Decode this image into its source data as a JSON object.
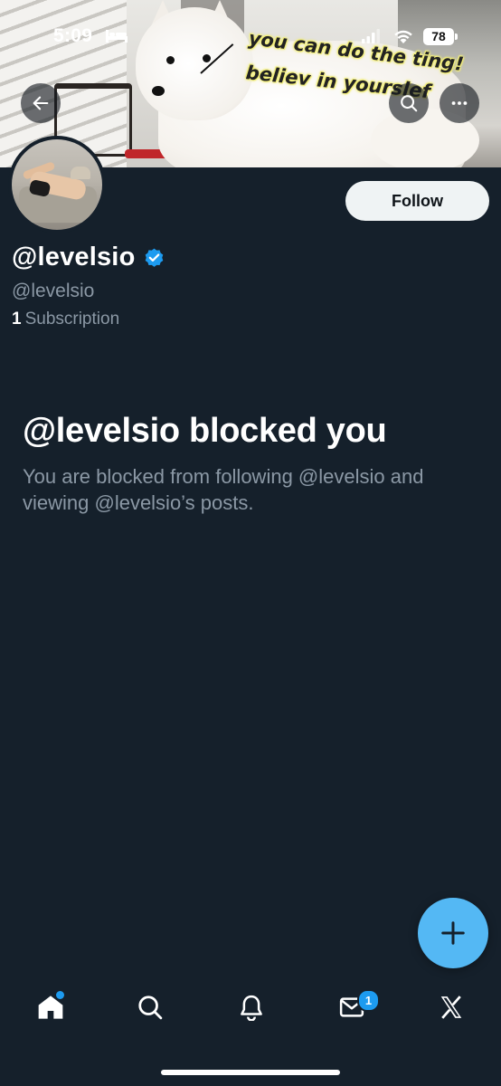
{
  "status_bar": {
    "time": "5:09",
    "battery": "78"
  },
  "banner": {
    "caption_line1": "you can do the ting!",
    "caption_line2": "believ in yourslef"
  },
  "header": {
    "back_icon": "arrow-left-icon",
    "search_icon": "search-icon",
    "more_icon": "more-horizontal-icon"
  },
  "profile": {
    "display_name": "@levelsio",
    "handle": "@levelsio",
    "subscription_count": "1",
    "subscription_label": "Subscription",
    "follow_label": "Follow",
    "verified_color": "#1d9bf0"
  },
  "blocked": {
    "title": "@levelsio blocked you",
    "description": "You are blocked from following @levelsio and viewing @levelsio’s posts."
  },
  "tabbar": {
    "items": [
      {
        "name": "home",
        "icon": "home-icon",
        "dot": true
      },
      {
        "name": "search",
        "icon": "search-icon"
      },
      {
        "name": "notifications",
        "icon": "bell-icon"
      },
      {
        "name": "messages",
        "icon": "envelope-icon",
        "badge": "1"
      },
      {
        "name": "grok",
        "icon": "x-logo-icon"
      }
    ]
  },
  "colors": {
    "background": "#15202b",
    "accent": "#1d9bf0",
    "fab": "#54b8f4",
    "secondary_text": "#8b98a5"
  }
}
